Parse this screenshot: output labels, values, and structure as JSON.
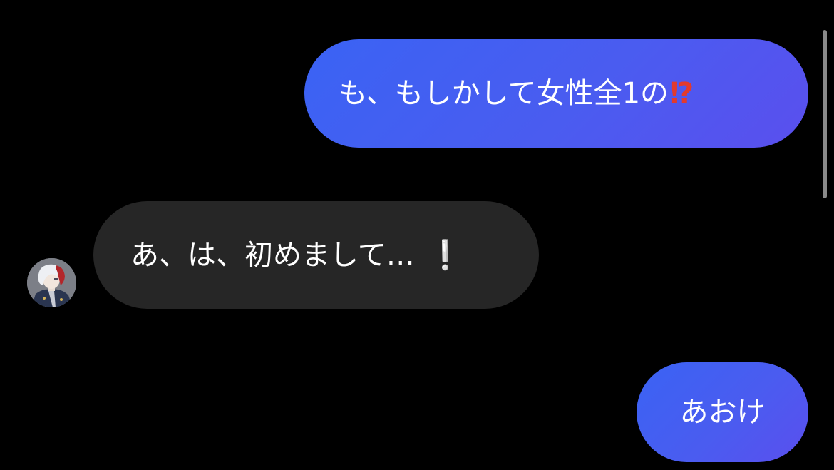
{
  "messages": [
    {
      "direction": "outgoing",
      "text": "も、もしかして女性全1の",
      "emoji": "⁉"
    },
    {
      "direction": "incoming",
      "text": "あ、は、初めまして…",
      "emoji": "❕"
    },
    {
      "direction": "outgoing",
      "text": "あおけ"
    }
  ],
  "avatar": {
    "icon": "anime-character-avatar"
  },
  "colors": {
    "background": "#000000",
    "outgoing_bubble": "#3d60f2",
    "incoming_bubble": "#262626",
    "text": "#ffffff",
    "emoji_red": "#e23a2e"
  }
}
